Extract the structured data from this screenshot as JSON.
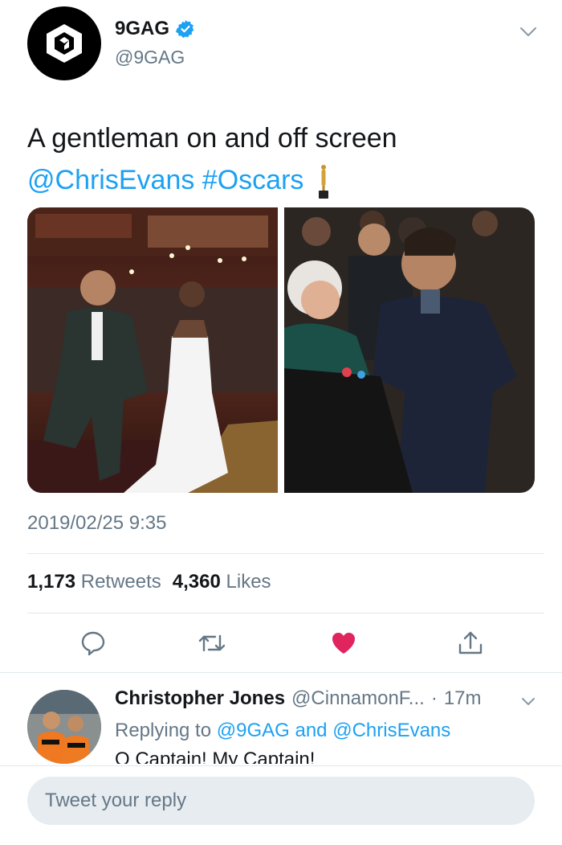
{
  "author": {
    "name": "9GAG",
    "handle": "@9GAG",
    "verified": true,
    "avatar_icon": "9gag-logo-icon"
  },
  "tweet": {
    "text": "A gentleman on and off screen",
    "mention": "@ChrisEvans",
    "hashtag": "#Oscars",
    "hashtag_emoji": "oscar-statuette-icon",
    "timestamp": "2019/02/25 9:35"
  },
  "stats": {
    "retweets_count": "1,173",
    "retweets_label": "Retweets",
    "likes_count": "4,360",
    "likes_label": "Likes"
  },
  "actions": [
    {
      "name": "reply",
      "icon": "speech-bubble-icon"
    },
    {
      "name": "retweet",
      "icon": "retweet-icon"
    },
    {
      "name": "like",
      "icon": "heart-icon",
      "active": true
    },
    {
      "name": "share",
      "icon": "share-icon"
    }
  ],
  "reply": {
    "name": "Christopher Jones",
    "handle": "@CinnamonF...",
    "separator": "·",
    "time": "17m",
    "replying_prefix": "Replying to",
    "replying_user1": "@9GAG",
    "replying_and": "and",
    "replying_user2": "@ChrisEvans",
    "text": "O Captain! My Captain!"
  },
  "composer": {
    "placeholder": "Tweet your reply"
  },
  "colors": {
    "link": "#1da1f2",
    "secondary_text": "#657786",
    "like_active": "#e0245e",
    "divider": "#e1e8ed"
  }
}
